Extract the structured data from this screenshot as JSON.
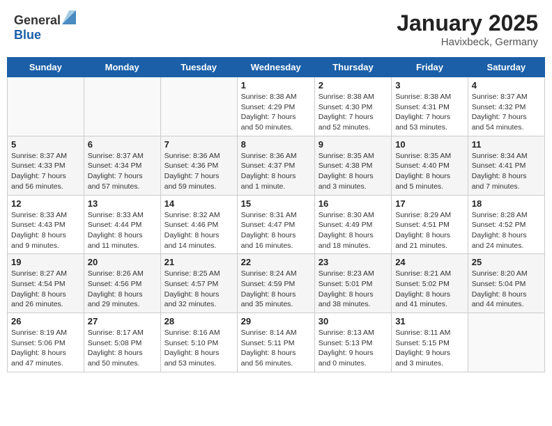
{
  "header": {
    "logo_general": "General",
    "logo_blue": "Blue",
    "title": "January 2025",
    "subtitle": "Havixbeck, Germany"
  },
  "days_of_week": [
    "Sunday",
    "Monday",
    "Tuesday",
    "Wednesday",
    "Thursday",
    "Friday",
    "Saturday"
  ],
  "weeks": [
    [
      {
        "day": "",
        "info": ""
      },
      {
        "day": "",
        "info": ""
      },
      {
        "day": "",
        "info": ""
      },
      {
        "day": "1",
        "info": "Sunrise: 8:38 AM\nSunset: 4:29 PM\nDaylight: 7 hours\nand 50 minutes."
      },
      {
        "day": "2",
        "info": "Sunrise: 8:38 AM\nSunset: 4:30 PM\nDaylight: 7 hours\nand 52 minutes."
      },
      {
        "day": "3",
        "info": "Sunrise: 8:38 AM\nSunset: 4:31 PM\nDaylight: 7 hours\nand 53 minutes."
      },
      {
        "day": "4",
        "info": "Sunrise: 8:37 AM\nSunset: 4:32 PM\nDaylight: 7 hours\nand 54 minutes."
      }
    ],
    [
      {
        "day": "5",
        "info": "Sunrise: 8:37 AM\nSunset: 4:33 PM\nDaylight: 7 hours\nand 56 minutes."
      },
      {
        "day": "6",
        "info": "Sunrise: 8:37 AM\nSunset: 4:34 PM\nDaylight: 7 hours\nand 57 minutes."
      },
      {
        "day": "7",
        "info": "Sunrise: 8:36 AM\nSunset: 4:36 PM\nDaylight: 7 hours\nand 59 minutes."
      },
      {
        "day": "8",
        "info": "Sunrise: 8:36 AM\nSunset: 4:37 PM\nDaylight: 8 hours\nand 1 minute."
      },
      {
        "day": "9",
        "info": "Sunrise: 8:35 AM\nSunset: 4:38 PM\nDaylight: 8 hours\nand 3 minutes."
      },
      {
        "day": "10",
        "info": "Sunrise: 8:35 AM\nSunset: 4:40 PM\nDaylight: 8 hours\nand 5 minutes."
      },
      {
        "day": "11",
        "info": "Sunrise: 8:34 AM\nSunset: 4:41 PM\nDaylight: 8 hours\nand 7 minutes."
      }
    ],
    [
      {
        "day": "12",
        "info": "Sunrise: 8:33 AM\nSunset: 4:43 PM\nDaylight: 8 hours\nand 9 minutes."
      },
      {
        "day": "13",
        "info": "Sunrise: 8:33 AM\nSunset: 4:44 PM\nDaylight: 8 hours\nand 11 minutes."
      },
      {
        "day": "14",
        "info": "Sunrise: 8:32 AM\nSunset: 4:46 PM\nDaylight: 8 hours\nand 14 minutes."
      },
      {
        "day": "15",
        "info": "Sunrise: 8:31 AM\nSunset: 4:47 PM\nDaylight: 8 hours\nand 16 minutes."
      },
      {
        "day": "16",
        "info": "Sunrise: 8:30 AM\nSunset: 4:49 PM\nDaylight: 8 hours\nand 18 minutes."
      },
      {
        "day": "17",
        "info": "Sunrise: 8:29 AM\nSunset: 4:51 PM\nDaylight: 8 hours\nand 21 minutes."
      },
      {
        "day": "18",
        "info": "Sunrise: 8:28 AM\nSunset: 4:52 PM\nDaylight: 8 hours\nand 24 minutes."
      }
    ],
    [
      {
        "day": "19",
        "info": "Sunrise: 8:27 AM\nSunset: 4:54 PM\nDaylight: 8 hours\nand 26 minutes."
      },
      {
        "day": "20",
        "info": "Sunrise: 8:26 AM\nSunset: 4:56 PM\nDaylight: 8 hours\nand 29 minutes."
      },
      {
        "day": "21",
        "info": "Sunrise: 8:25 AM\nSunset: 4:57 PM\nDaylight: 8 hours\nand 32 minutes."
      },
      {
        "day": "22",
        "info": "Sunrise: 8:24 AM\nSunset: 4:59 PM\nDaylight: 8 hours\nand 35 minutes."
      },
      {
        "day": "23",
        "info": "Sunrise: 8:23 AM\nSunset: 5:01 PM\nDaylight: 8 hours\nand 38 minutes."
      },
      {
        "day": "24",
        "info": "Sunrise: 8:21 AM\nSunset: 5:02 PM\nDaylight: 8 hours\nand 41 minutes."
      },
      {
        "day": "25",
        "info": "Sunrise: 8:20 AM\nSunset: 5:04 PM\nDaylight: 8 hours\nand 44 minutes."
      }
    ],
    [
      {
        "day": "26",
        "info": "Sunrise: 8:19 AM\nSunset: 5:06 PM\nDaylight: 8 hours\nand 47 minutes."
      },
      {
        "day": "27",
        "info": "Sunrise: 8:17 AM\nSunset: 5:08 PM\nDaylight: 8 hours\nand 50 minutes."
      },
      {
        "day": "28",
        "info": "Sunrise: 8:16 AM\nSunset: 5:10 PM\nDaylight: 8 hours\nand 53 minutes."
      },
      {
        "day": "29",
        "info": "Sunrise: 8:14 AM\nSunset: 5:11 PM\nDaylight: 8 hours\nand 56 minutes."
      },
      {
        "day": "30",
        "info": "Sunrise: 8:13 AM\nSunset: 5:13 PM\nDaylight: 9 hours\nand 0 minutes."
      },
      {
        "day": "31",
        "info": "Sunrise: 8:11 AM\nSunset: 5:15 PM\nDaylight: 9 hours\nand 3 minutes."
      },
      {
        "day": "",
        "info": ""
      }
    ]
  ]
}
